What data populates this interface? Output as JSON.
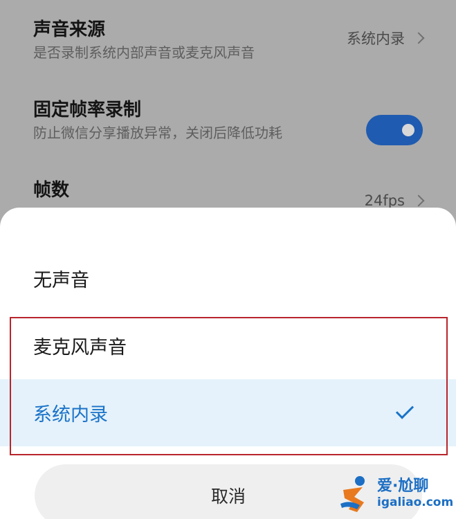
{
  "settings": {
    "audio_source": {
      "title": "声音来源",
      "subtitle": "是否录制系统内部声音或麦克风声音",
      "value": "系统内录"
    },
    "fixed_fps": {
      "title": "固定帧率录制",
      "subtitle": "防止微信分享播放异常，关闭后降低功耗",
      "enabled": true
    },
    "frame_rate": {
      "title": "帧数",
      "value": "24fps"
    }
  },
  "sheet": {
    "options": [
      {
        "label": "无声音",
        "selected": false
      },
      {
        "label": "麦克风声音",
        "selected": false
      },
      {
        "label": "系统内录",
        "selected": true
      }
    ],
    "cancel_label": "取消"
  },
  "watermark": {
    "line1": "爱·尬聊",
    "line2": "igaliao.com"
  },
  "colors": {
    "accent": "#1a73c8",
    "toggle_on": "#1f5bb0",
    "selected_bg": "#e5f2fb",
    "highlight_border": "#b8242b"
  }
}
